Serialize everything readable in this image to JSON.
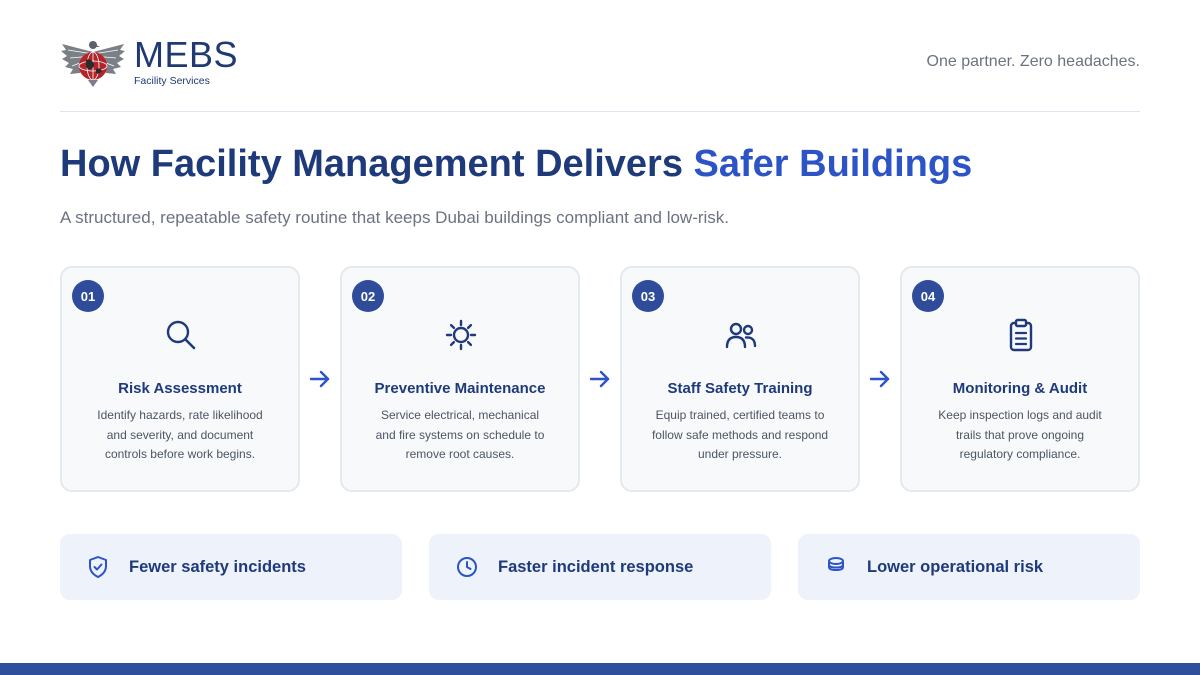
{
  "brand": {
    "name": "MEBS",
    "subtitle": "Facility Services"
  },
  "tagline": "One partner. Zero headaches.",
  "title": {
    "main": "How Facility Management Delivers ",
    "accent": "Safer Buildings"
  },
  "subtitle": "A structured, repeatable safety routine that keeps Dubai buildings compliant and low-risk.",
  "steps": [
    {
      "number": "01",
      "icon": "search-icon",
      "title": "Risk Assessment",
      "description": "Identify hazards, rate likelihood and severity, and document controls before work begins."
    },
    {
      "number": "02",
      "icon": "gear-icon",
      "title": "Preventive Maintenance",
      "description": "Service electrical, mechanical and fire systems on schedule to remove root causes."
    },
    {
      "number": "03",
      "icon": "users-icon",
      "title": "Staff Safety Training",
      "description": "Equip trained, certified teams to follow safe methods and respond under pressure."
    },
    {
      "number": "04",
      "icon": "clipboard-icon",
      "title": "Monitoring & Audit",
      "description": "Keep inspection logs and audit trails that prove ongoing regulatory compliance."
    }
  ],
  "benefits": [
    {
      "icon": "shield-check-icon",
      "label": "Fewer safety incidents"
    },
    {
      "icon": "clock-icon",
      "label": "Faster incident response"
    },
    {
      "icon": "database-icon",
      "label": "Lower operational risk"
    }
  ],
  "colors": {
    "navy": "#1e3a7b",
    "accent": "#2c54c6",
    "badge": "#2e4c9a",
    "card_bg": "#f8f9fb",
    "benefit_bg": "#eef2fb",
    "footer_bar": "#2f4e9c"
  }
}
